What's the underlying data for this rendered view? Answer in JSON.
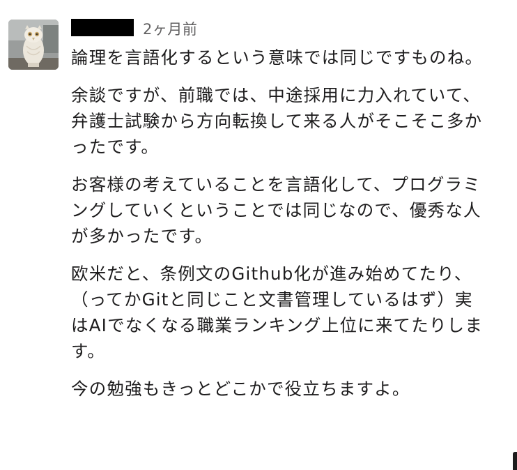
{
  "message": {
    "timestamp": "2ヶ月前",
    "paragraphs": [
      "論理を言語化するという意味では同じですものね。",
      "余談ですが、前職では、中途採用に力入れていて、弁護士試験から方向転換して来る人がそこそこ多かったです。",
      "お客様の考えていることを言語化して、プログラミングしていくということでは同じなので、優秀な人が多かったです。",
      "欧米だと、条例文のGithub化が進み始めてたり、（ってかGitと同じこと文書管理しているはず）実はAIでなくなる職業ランキング上位に来てたりします。",
      "今の勉強もきっとどこかで役立ちますよ。"
    ]
  }
}
